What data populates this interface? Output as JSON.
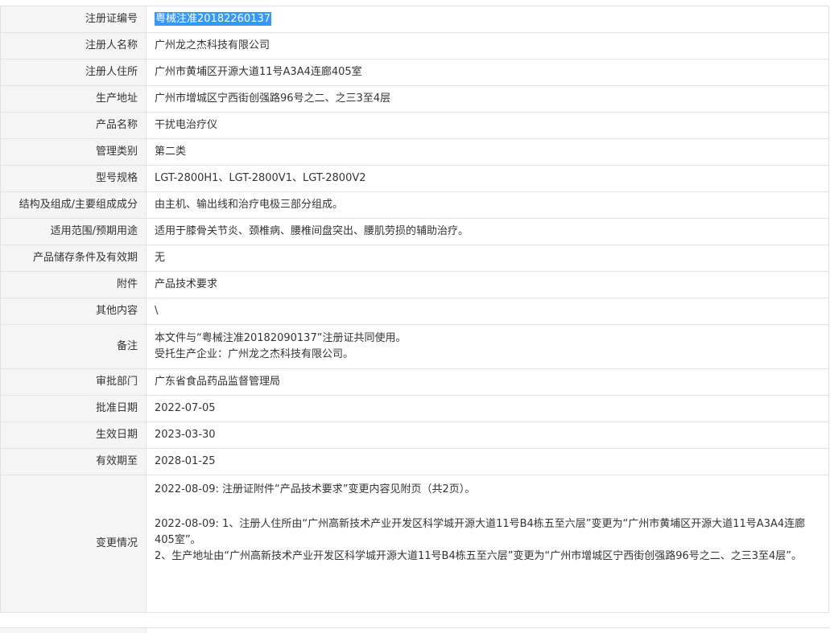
{
  "rows": [
    {
      "label": "注册证编号",
      "value": "粤械注准20182260137"
    },
    {
      "label": "注册人名称",
      "value": "广州龙之杰科技有限公司"
    },
    {
      "label": "注册人住所",
      "value": "广州市黄埔区开源大道11号A3A4连廊405室"
    },
    {
      "label": "生产地址",
      "value": "广州市增城区宁西街创强路96号之二、之三3至4层"
    },
    {
      "label": "产品名称",
      "value": "干扰电治疗仪"
    },
    {
      "label": "管理类别",
      "value": "第二类"
    },
    {
      "label": "型号规格",
      "value": "LGT-2800H1、LGT-2800V1、LGT-2800V2"
    },
    {
      "label": "结构及组成/主要组成成分",
      "value": "由主机、输出线和治疗电极三部分组成。"
    },
    {
      "label": "适用范围/预期用途",
      "value": "适用于膝骨关节炎、颈椎病、腰椎间盘突出、腰肌劳损的辅助治疗。"
    },
    {
      "label": "产品储存条件及有效期",
      "value": "无"
    },
    {
      "label": "附件",
      "value": "产品技术要求"
    },
    {
      "label": "其他内容",
      "value": "\\"
    },
    {
      "label": "备注",
      "lines": [
        "本文件与“粤械注准20182090137”注册证共同使用。",
        "受托生产企业：广州龙之杰科技有限公司。"
      ]
    },
    {
      "label": "审批部门",
      "value": "广东省食品药品监督管理局"
    },
    {
      "label": "批准日期",
      "value": "2022-07-05"
    },
    {
      "label": "生效日期",
      "value": "2023-03-30"
    },
    {
      "label": "有效期至",
      "value": "2028-01-25"
    },
    {
      "label": "变更情况",
      "lines": [
        "2022-08-09: 注册证附件“产品技术要求”变更内容见附页（共2页）。",
        "2022-08-09: 1、注册人住所由“广州高新技术产业开发区科学城开源大道11号B4栋五至六层”变更为“广州市黄埔区开源大道11号A3A4连廊405室”。",
        "2、生产地址由“广州高新技术产业开发区科学城开源大道11号B4栋五至六层”变更为“广州市增城区宁西街创强路96号之二、之三3至4层”。"
      ]
    }
  ]
}
